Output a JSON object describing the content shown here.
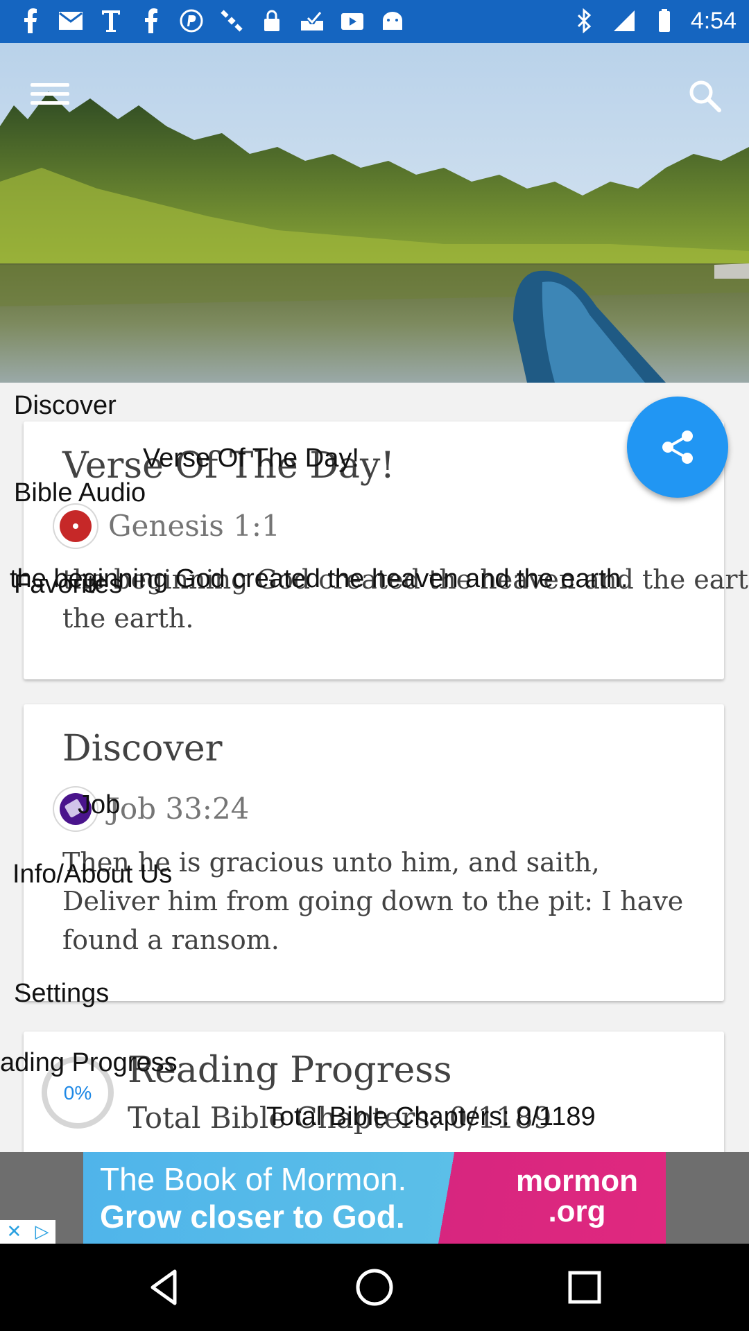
{
  "status_bar": {
    "time": "4:54",
    "icons": [
      "facebook-icon",
      "mail-icon",
      "text-icon",
      "facebook-icon",
      "paypal-icon",
      "satellite-icon",
      "lock-icon",
      "inbox-icon",
      "video-icon",
      "android-icon"
    ]
  },
  "header": {
    "menu_icon": "hamburger-icon",
    "search_icon": "search-icon"
  },
  "overlay_menu": {
    "discover": "Discover",
    "bible_audio": "Bible Audio",
    "favorites": "Favorites",
    "info_about": "Info/About Us",
    "settings": "Settings",
    "reading_progress": "ading Progress"
  },
  "verse_card": {
    "title": "Verse Of The Day!",
    "title_overlay": "Verse Of The Day!",
    "reference": "Genesis 1:1",
    "text_overlay": "the beginning God created the heaven and the earth.",
    "text_line1": "the beginning God created the heaven and the earth.",
    "text_line2": "the earth."
  },
  "discover_card": {
    "title": "Discover",
    "reference": "Job 33:24",
    "book_overlay": "Job",
    "text": "Then he is gracious unto him, and saith, Deliver him from going down to the pit: I have found a ransom."
  },
  "progress_card": {
    "title": "Reading Progress",
    "percent": "0%",
    "progress_fraction": 0,
    "total_chapters": "Total Bible Chapters: 0/1189",
    "total_chapters_overlay": "Total Bible Chapters: 0/1189"
  },
  "ad": {
    "line1": "The Book of Mormon.",
    "line2": "Grow closer to God.",
    "brand_line1": "mormon",
    "brand_line2": ".org"
  },
  "colors": {
    "status_bar": "#1565c0",
    "fab": "#2196f3",
    "progress_text": "#1e88e5"
  }
}
